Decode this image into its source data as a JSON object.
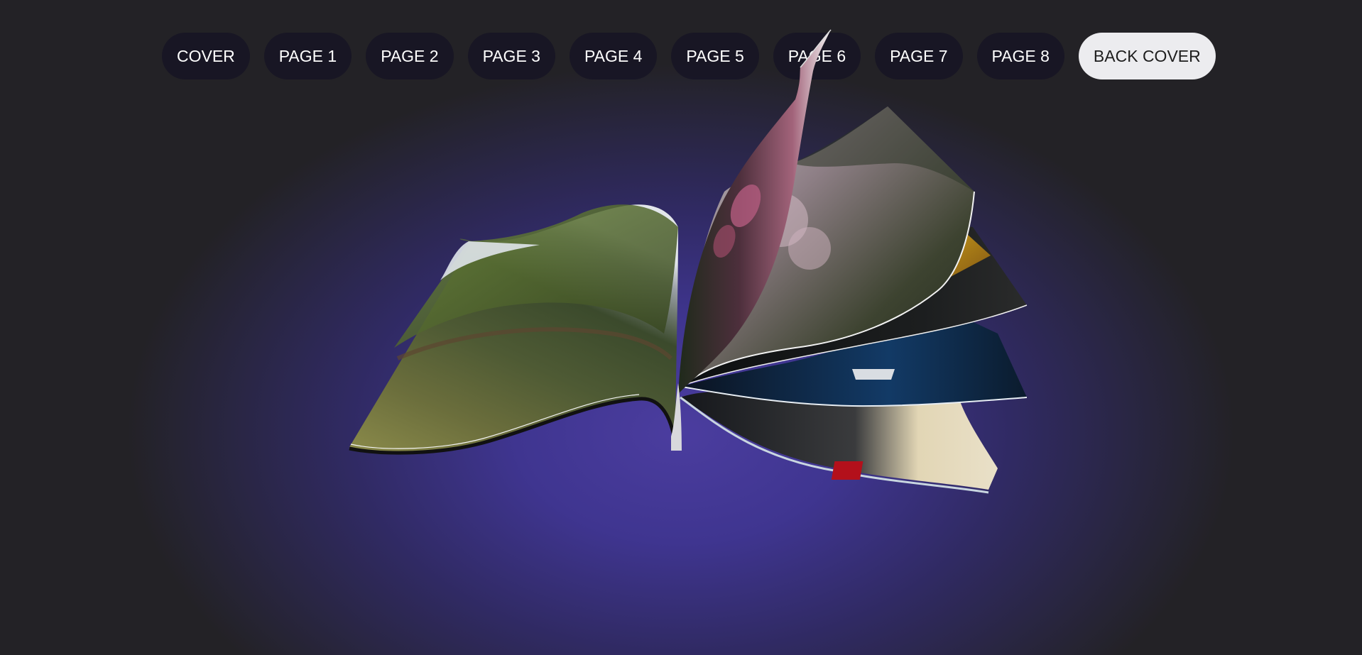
{
  "navigation": {
    "buttons": [
      {
        "label": "COVER",
        "active": false
      },
      {
        "label": "PAGE 1",
        "active": false
      },
      {
        "label": "PAGE 2",
        "active": false
      },
      {
        "label": "PAGE 3",
        "active": false
      },
      {
        "label": "PAGE 4",
        "active": false
      },
      {
        "label": "PAGE 5",
        "active": false
      },
      {
        "label": "PAGE 6",
        "active": false
      },
      {
        "label": "PAGE 7",
        "active": false
      },
      {
        "label": "PAGE 8",
        "active": false
      },
      {
        "label": "BACK COVER",
        "active": true
      }
    ]
  },
  "colors": {
    "background_center": "#4b3d9f",
    "background_edge": "#232226",
    "button_bg": "#17152a",
    "button_active_bg": "#ececef",
    "button_text": "#ffffff",
    "button_active_text": "#1d1d1d"
  }
}
